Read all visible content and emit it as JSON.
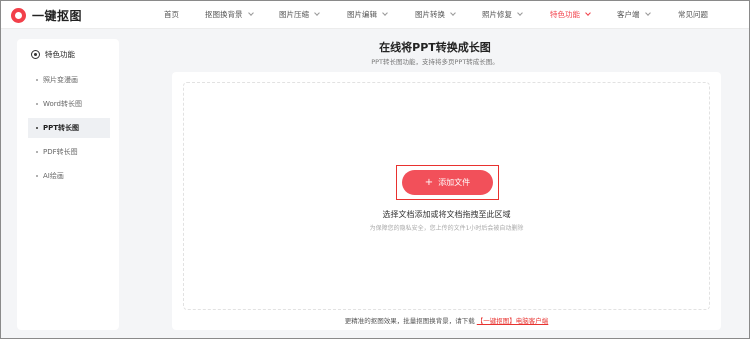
{
  "brand": {
    "name": "一键抠图",
    "accent": "#f2404a"
  },
  "nav": {
    "items": [
      {
        "label": "首页",
        "has_dropdown": false,
        "active": false
      },
      {
        "label": "抠图换背景",
        "has_dropdown": true,
        "active": false
      },
      {
        "label": "图片压缩",
        "has_dropdown": true,
        "active": false
      },
      {
        "label": "图片编辑",
        "has_dropdown": true,
        "active": false
      },
      {
        "label": "图片转换",
        "has_dropdown": true,
        "active": false
      },
      {
        "label": "照片修复",
        "has_dropdown": true,
        "active": false
      },
      {
        "label": "特色功能",
        "has_dropdown": true,
        "active": true
      },
      {
        "label": "客户端",
        "has_dropdown": true,
        "active": false
      },
      {
        "label": "常见问题",
        "has_dropdown": false,
        "active": false
      }
    ]
  },
  "sidebar": {
    "heading": "特色功能",
    "heading_icon": "target-icon",
    "items": [
      {
        "label": "照片变漫画",
        "active": false
      },
      {
        "label": "Word转长图",
        "active": false
      },
      {
        "label": "PPT转长图",
        "active": true
      },
      {
        "label": "PDF转长图",
        "active": false
      },
      {
        "label": "AI绘画",
        "active": false
      }
    ]
  },
  "main": {
    "title": "在线将PPT转换成长图",
    "subtitle": "PPT转长图功能，支持将多页PPT转成长图。",
    "add_button_label": "添加文件",
    "drop_hint": "选择文档添加或将文档拖拽至此区域",
    "privacy_note": "为保障您的隐私安全，您上传的文件1小时后会被自动删除",
    "footer_text": "更精准的抠图效果，批量抠图换背景，请下载",
    "footer_link": "【一键抠图】电脑客户端"
  }
}
